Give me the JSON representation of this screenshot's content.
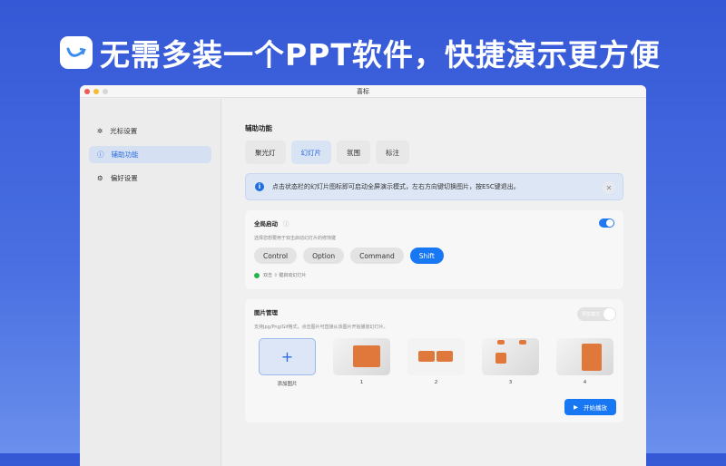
{
  "banner": {
    "headline": "无需多装一个PPT软件，快捷演示更方便"
  },
  "window": {
    "title": "喜标"
  },
  "sidebar": {
    "items": [
      {
        "label": "光标设置",
        "icon": "sparkle-icon"
      },
      {
        "label": "辅助功能",
        "icon": "accessibility-icon"
      },
      {
        "label": "偏好设置",
        "icon": "gear-icon"
      }
    ]
  },
  "main": {
    "section_title": "辅助功能",
    "tabs": [
      "聚光灯",
      "幻灯片",
      "氛围",
      "标注"
    ],
    "info": "点击状态栏的幻灯片图标即可启动全屏演示模式，左右方向键切换图片，按ESC键退出。",
    "global": {
      "title": "全局启动",
      "subtitle": "选择您想要用于双击启动幻灯片的修饰键",
      "keys": [
        "Control",
        "Option",
        "Command",
        "Shift"
      ],
      "hint": "双击 ⇧ 键启动幻灯片",
      "enabled": true
    },
    "images": {
      "title": "图片管理",
      "subtitle": "支持Jpg/Png/Gif格式，点击图片可直接从该图片开始播放幻灯片。",
      "toggle_label": "预览模式",
      "add_label": "添加图片",
      "items": [
        "1",
        "2",
        "3",
        "4"
      ],
      "play_label": "开始播放"
    }
  },
  "colors": {
    "accent": "#1877f2",
    "background": "#3558d6"
  }
}
